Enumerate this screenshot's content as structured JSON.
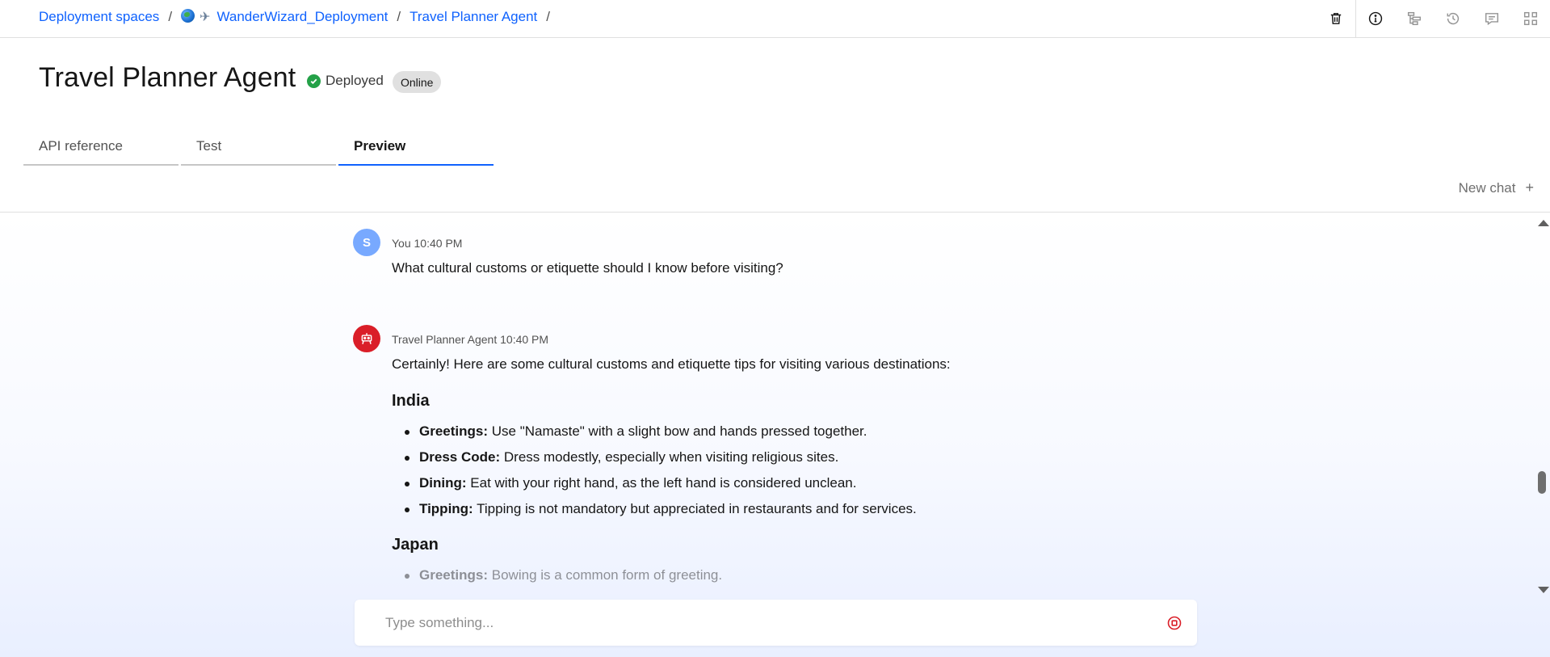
{
  "breadcrumb": {
    "items": [
      "Deployment spaces",
      "WanderWizard_Deployment",
      "Travel Planner Agent"
    ],
    "separator": "/"
  },
  "toolbar": {
    "icons": [
      "trash-icon",
      "information-icon",
      "tree-view-icon",
      "history-icon",
      "chat-icon",
      "apps-icon"
    ]
  },
  "header": {
    "title": "Travel Planner Agent",
    "status_label": "Deployed",
    "badge": "Online"
  },
  "tabs": [
    {
      "label": "API reference",
      "active": false
    },
    {
      "label": "Test",
      "active": false
    },
    {
      "label": "Preview",
      "active": true
    }
  ],
  "new_chat": {
    "label": "New chat"
  },
  "messages": [
    {
      "role": "user",
      "avatar_letter": "S",
      "sender": "You",
      "time": "10:40 PM",
      "text": "What cultural customs or etiquette should I know before visiting?"
    },
    {
      "role": "agent",
      "sender": "Travel Planner Agent",
      "time": "10:40 PM",
      "intro": "Certainly! Here are some cultural customs and etiquette tips for visiting various destinations:",
      "sections": [
        {
          "heading": "India",
          "points": [
            {
              "label": "Greetings:",
              "text": "Use \"Namaste\" with a slight bow and hands pressed together."
            },
            {
              "label": "Dress Code:",
              "text": "Dress modestly, especially when visiting religious sites."
            },
            {
              "label": "Dining:",
              "text": "Eat with your right hand, as the left hand is considered unclean."
            },
            {
              "label": "Tipping:",
              "text": "Tipping is not mandatory but appreciated in restaurants and for services."
            }
          ]
        },
        {
          "heading": "Japan",
          "points": [
            {
              "label": "Greetings:",
              "text": "Bowing is a common form of greeting."
            }
          ]
        }
      ]
    }
  ],
  "composer": {
    "placeholder": "Type something..."
  },
  "colors": {
    "link": "#0f62fe",
    "deployed_green": "#24a148",
    "agent_avatar": "#da1e28",
    "user_avatar": "#78a9ff",
    "stop_icon": "#da1e28"
  }
}
